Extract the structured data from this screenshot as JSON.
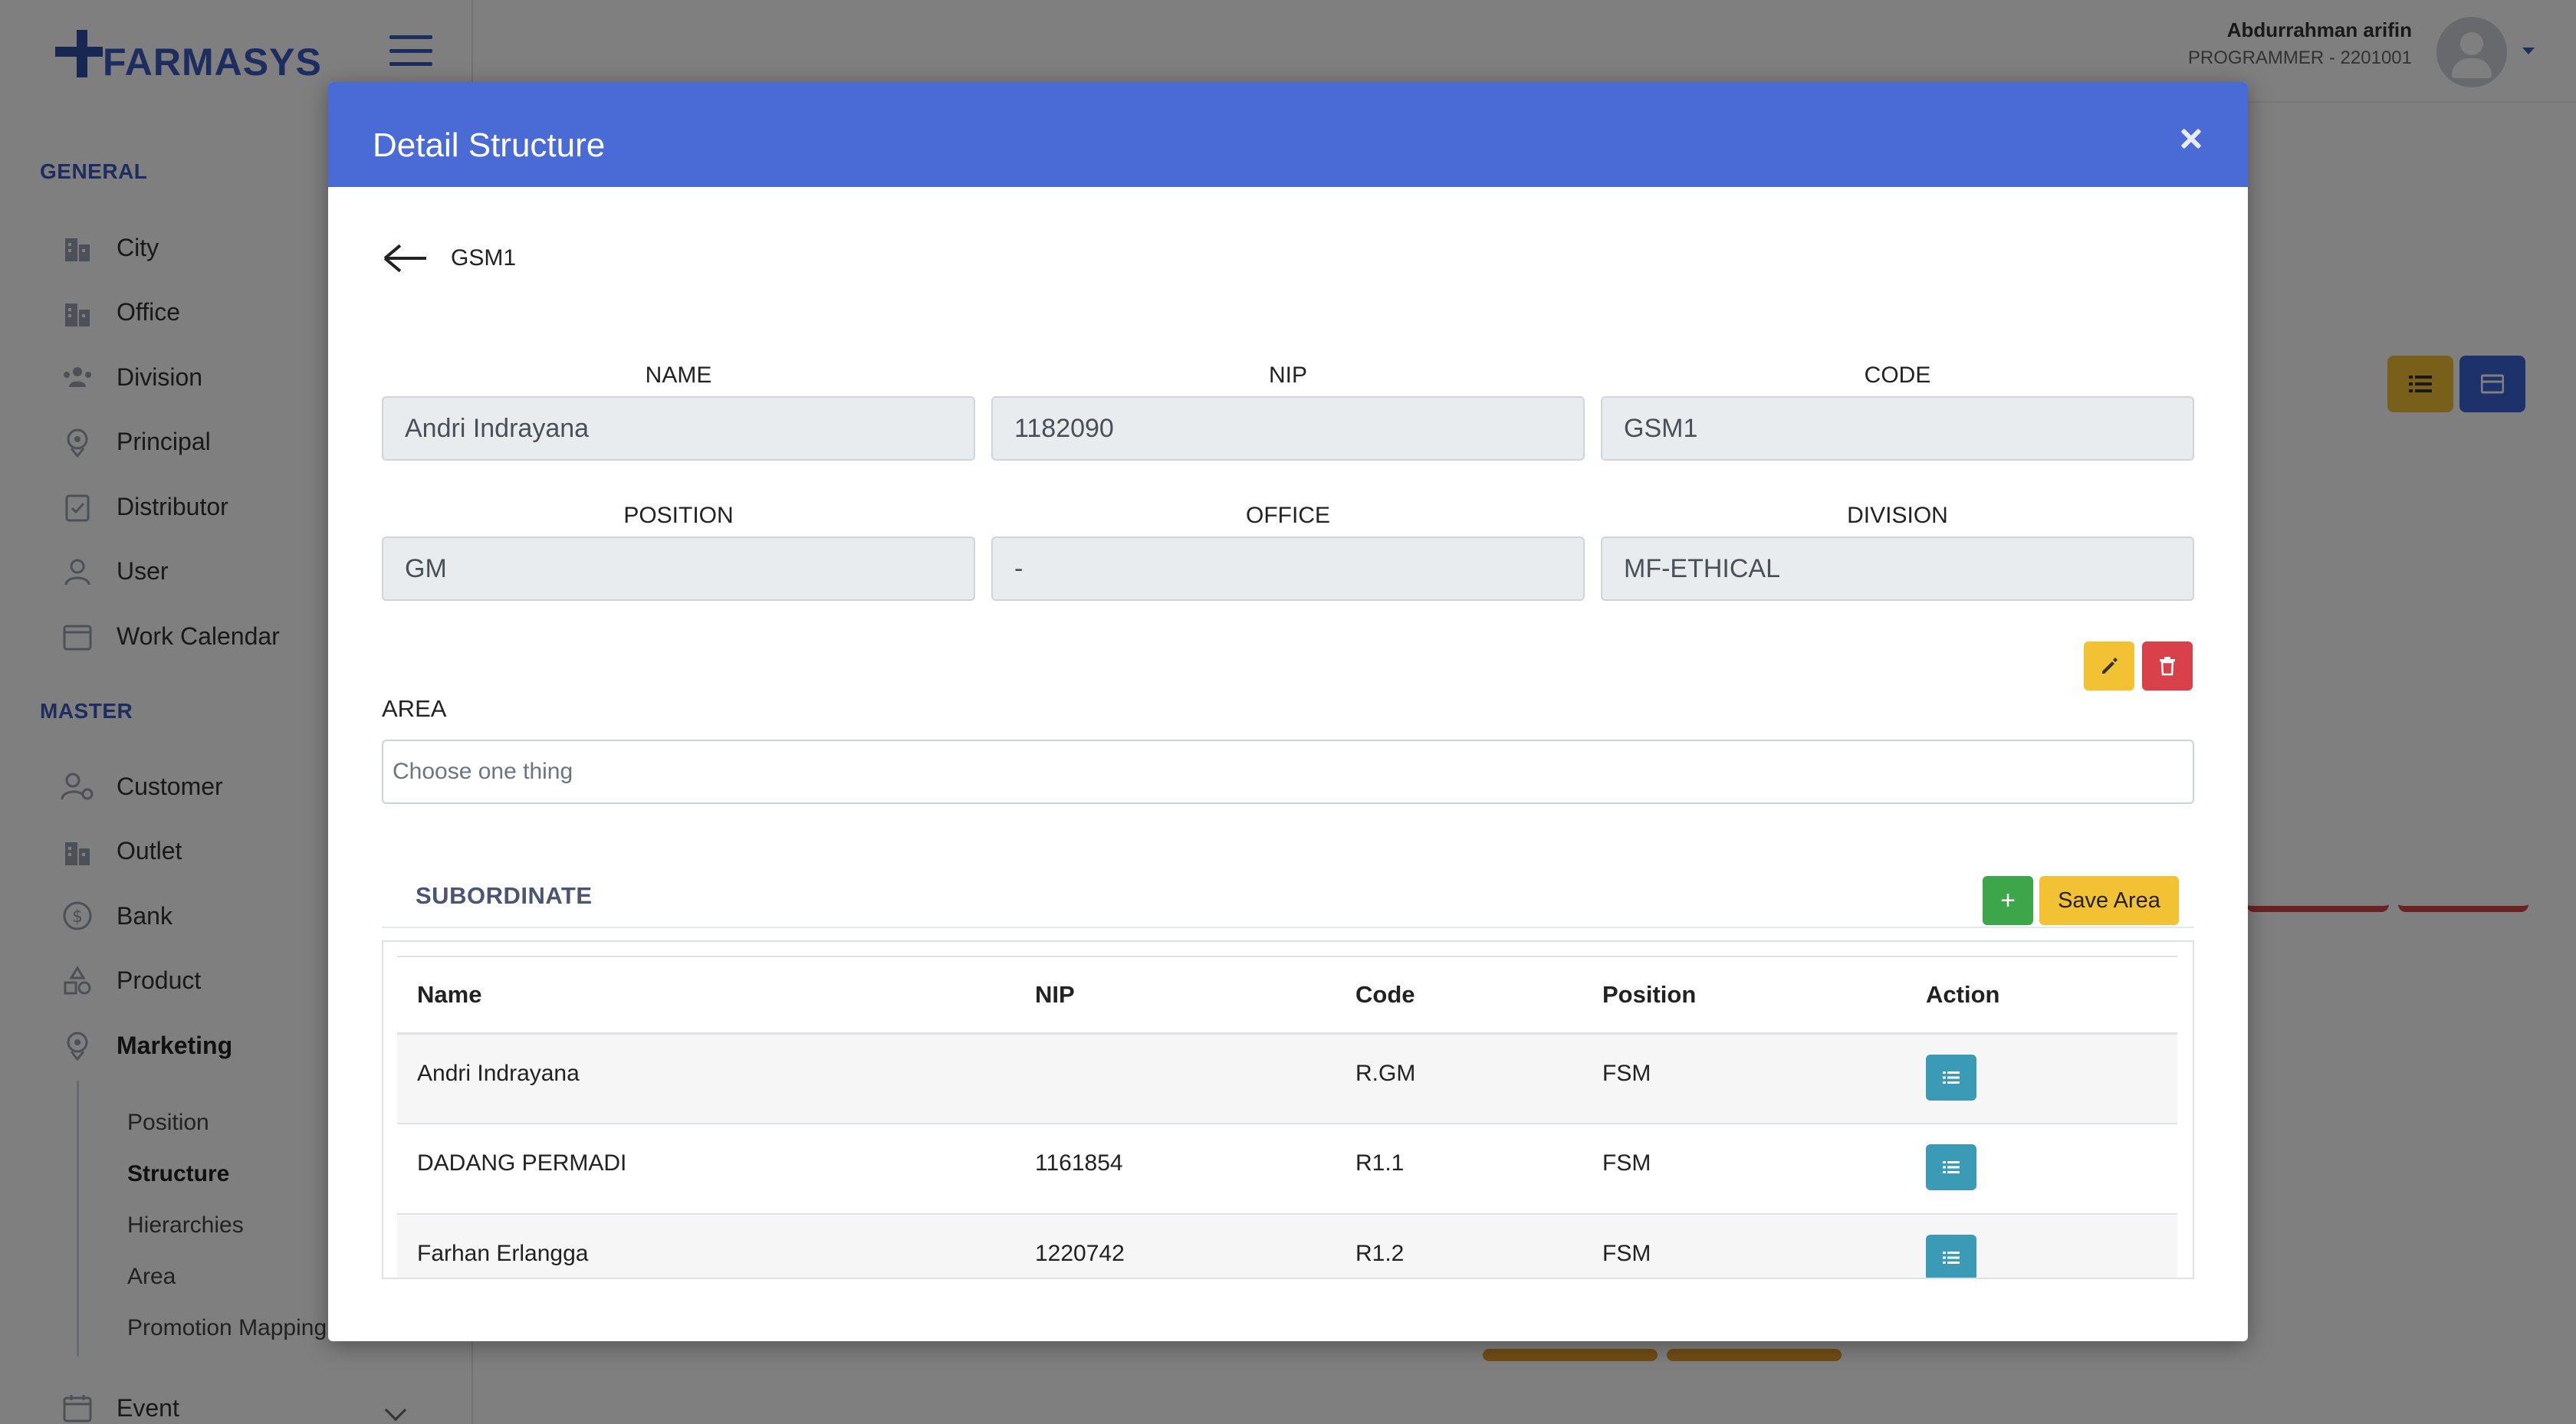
{
  "app": {
    "logo_text": "FARMASYS",
    "user_name": "Abdurrahman arifin",
    "user_role": "PROGRAMMER - 2201001"
  },
  "sidebar": {
    "general_title": "GENERAL",
    "general_items": [
      {
        "label": "City",
        "icon": "building-icon"
      },
      {
        "label": "Office",
        "icon": "office-icon"
      },
      {
        "label": "Division",
        "icon": "users-icon"
      },
      {
        "label": "Principal",
        "icon": "badge-icon"
      },
      {
        "label": "Distributor",
        "icon": "clipboard-check-icon"
      },
      {
        "label": "User",
        "icon": "user-icon"
      },
      {
        "label": "Work Calendar",
        "icon": "calendar-icon"
      }
    ],
    "master_title": "MASTER",
    "master_items": [
      {
        "label": "Customer",
        "icon": "user-gear-icon"
      },
      {
        "label": "Outlet",
        "icon": "building-icon"
      },
      {
        "label": "Bank",
        "icon": "dollar-circle-icon"
      },
      {
        "label": "Product",
        "icon": "shapes-icon"
      },
      {
        "label": "Marketing",
        "icon": "map-pin-icon"
      }
    ],
    "marketing_sub": [
      "Position",
      "Structure",
      "Hierarchies",
      "Area",
      "Promotion Mapping"
    ],
    "event_label": "Event"
  },
  "modal": {
    "title": "Detail Structure",
    "breadcrumb": "GSM1",
    "fields": {
      "name": {
        "label": "NAME",
        "value": "Andri Indrayana"
      },
      "nip": {
        "label": "NIP",
        "value": "1182090"
      },
      "code": {
        "label": "CODE",
        "value": "GSM1"
      },
      "position": {
        "label": "POSITION",
        "value": "GM"
      },
      "office": {
        "label": "OFFICE",
        "value": "-"
      },
      "division": {
        "label": "DIVISION",
        "value": "MF-ETHICAL"
      }
    },
    "area": {
      "label": "AREA",
      "placeholder": "Choose one thing"
    },
    "subordinate": {
      "title": "SUBORDINATE",
      "add_label": "+",
      "save_label": "Save Area",
      "columns": [
        "Name",
        "NIP",
        "Code",
        "Position",
        "Action"
      ],
      "rows": [
        {
          "name": "Andri Indrayana",
          "nip": "",
          "code": "R.GM",
          "position": "FSM"
        },
        {
          "name": "DADANG PERMADI",
          "nip": "1161854",
          "code": "R1.1",
          "position": "FSM"
        },
        {
          "name": "Farhan Erlangga",
          "nip": "1220742",
          "code": "R1.2",
          "position": "FSM"
        }
      ]
    }
  },
  "colors": {
    "primary": "#4a6bd6",
    "warning": "#f3c134",
    "danger": "#d9414a",
    "success": "#3ea64a",
    "info": "#3b9ab6"
  }
}
